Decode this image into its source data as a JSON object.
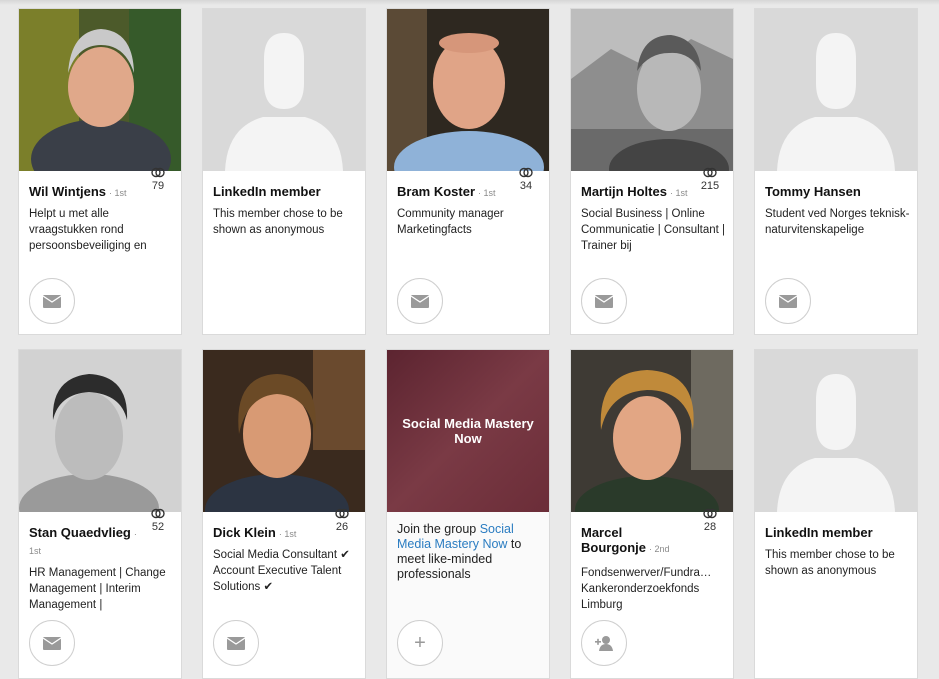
{
  "connections": [
    {
      "name": "Wil Wintjens",
      "degree": "1st",
      "shared": "79",
      "headline": "Helpt u met alle vraagstukken rond persoonsbeveiliging en",
      "action": "message"
    },
    {
      "name": "LinkedIn member",
      "degree": "",
      "shared": "",
      "headline": "This member chose to be shown as anonymous",
      "action": "none"
    },
    {
      "name": "Bram Koster",
      "degree": "1st",
      "shared": "34",
      "headline": "Community manager Marketingfacts",
      "action": "message"
    },
    {
      "name": "Martijn Holtes",
      "degree": "1st",
      "shared": "215",
      "headline": "Social Business | Online Communicatie | Consultant | Trainer bij",
      "action": "message"
    },
    {
      "name": "Tommy Hansen",
      "degree": "",
      "shared": "",
      "headline": "Student ved Norges teknisk-naturvitenskapelige",
      "action": "message"
    },
    {
      "name": "Stan Quaedvlieg",
      "degree": "1st",
      "shared": "52",
      "headline": "HR Management | Change Management | Interim Management |",
      "action": "message"
    },
    {
      "name": "Dick Klein",
      "degree": "1st",
      "shared": "26",
      "headline": "Social Media Consultant ✔ Account Executive Talent Solutions ✔",
      "action": "message"
    },
    {
      "name": "Marcel Bourgonje",
      "degree": "2nd",
      "shared": "28",
      "headline": "Fondsenwerver/Fundra… Kankeronderzoekfonds Limburg",
      "action": "connect"
    },
    {
      "name": "LinkedIn member",
      "degree": "",
      "shared": "",
      "headline": "This member chose to be shown as anonymous",
      "action": "none"
    }
  ],
  "group_card": {
    "title": "Social Media Mastery Now",
    "join_prefix": "Join the group ",
    "group_link": "Social Media Mastery Now",
    "join_suffix": " to meet like-minded professionals",
    "action_label": "+"
  },
  "colors": {
    "accent": "#2a7cc1",
    "background": "#e9e9e9",
    "group_banner": "#6b2d38"
  },
  "icons": {
    "message": "envelope-icon",
    "connect": "add-person-icon",
    "shared": "shared-connections-icon",
    "join": "plus-icon"
  }
}
